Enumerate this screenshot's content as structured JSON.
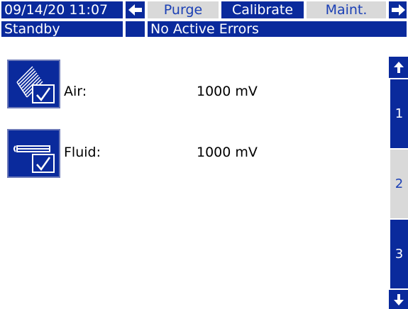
{
  "header": {
    "datetime": "09/14/20 11:07",
    "tabs": [
      {
        "label": "Purge"
      },
      {
        "label": "Calibrate"
      },
      {
        "label": "Maint."
      }
    ]
  },
  "status": {
    "mode": "Standby",
    "errors": "No Active Errors"
  },
  "rows": [
    {
      "label": "Air:",
      "value": "1000 mV",
      "icon": "air-calibrate-icon"
    },
    {
      "label": "Fluid:",
      "value": "1000 mV",
      "icon": "fluid-calibrate-icon"
    }
  ],
  "pages": [
    "1",
    "2",
    "3"
  ],
  "colors": {
    "accent": "#0a2a9c",
    "inactive_tab": "#d9d9d9"
  }
}
